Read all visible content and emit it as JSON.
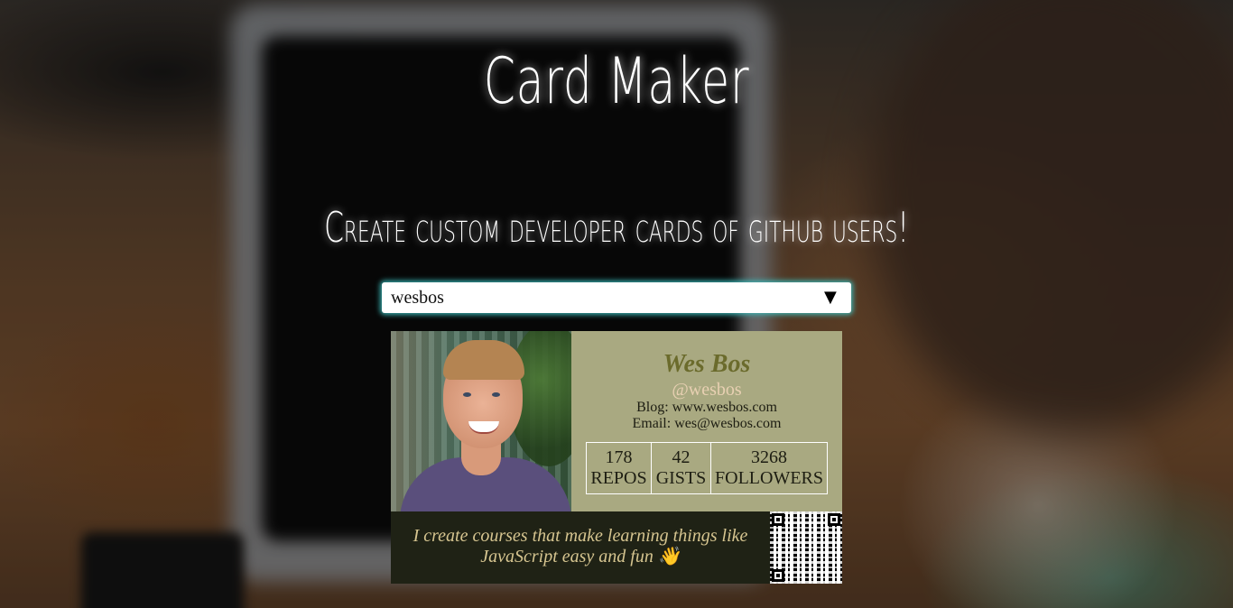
{
  "header": {
    "title": "Card Maker",
    "subtitle": "Create custom developer cards of github users!"
  },
  "search": {
    "value": "wesbos",
    "dropdown_icon": "caret-down-icon",
    "dropdown_glyph": "▼"
  },
  "card": {
    "name": "Wes Bos",
    "handle": "@wesbos",
    "blog": "Blog: www.wesbos.com",
    "email": "Email: wes@wesbos.com",
    "stats": [
      {
        "value": "178",
        "label": "REPOS"
      },
      {
        "value": "42",
        "label": "GISTS"
      },
      {
        "value": "3268",
        "label": "FOLLOWERS"
      }
    ],
    "bio": "I create courses that make learning things like JavaScript easy and fun 👋",
    "colors": {
      "info_bg": "#a9a981",
      "bio_bg": "#1f2215",
      "name": "#6b6b2c",
      "handle": "#e8d0b2",
      "bio_text": "#d6c590"
    }
  }
}
